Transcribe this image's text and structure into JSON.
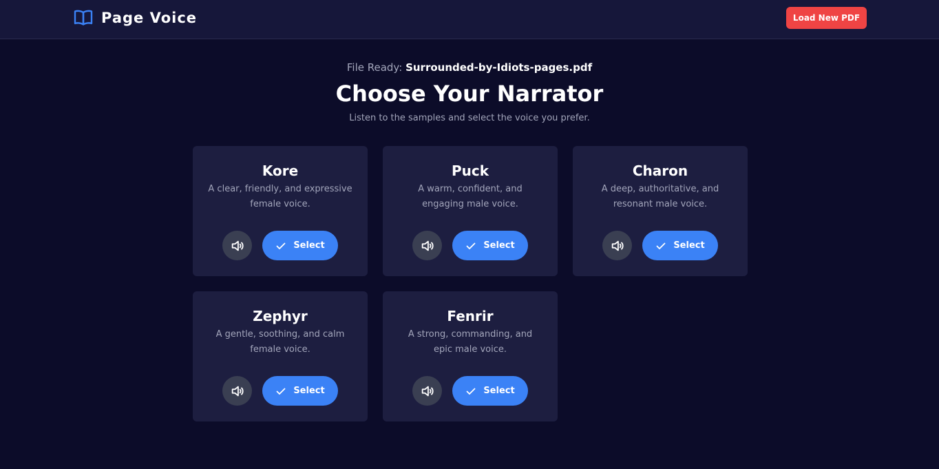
{
  "header": {
    "brand_name": "Page Voice",
    "brand_icon": "open-book-icon",
    "load_button_label": "Load New PDF"
  },
  "main": {
    "file_ready_label": "File Ready:",
    "file_name": "Surrounded-by-Idiots-pages.pdf",
    "title": "Choose Your Narrator",
    "subtitle": "Listen to the samples and select the voice you prefer."
  },
  "voices": [
    {
      "name": "Kore",
      "description": "A clear, friendly, and expressive female voice.",
      "select_label": "Select"
    },
    {
      "name": "Puck",
      "description": "A warm, confident, and engaging male voice.",
      "select_label": "Select"
    },
    {
      "name": "Charon",
      "description": "A deep, authoritative, and resonant male voice.",
      "select_label": "Select"
    },
    {
      "name": "Zephyr",
      "description": "A gentle, soothing, and calm female voice.",
      "select_label": "Select"
    },
    {
      "name": "Fenrir",
      "description": "A strong, commanding, and epic male voice.",
      "select_label": "Select"
    }
  ],
  "icons": {
    "play": "speaker-icon",
    "select": "check-icon"
  },
  "colors": {
    "background": "#0c0c29",
    "header_bg": "#16173a",
    "card_bg": "#1d1e40",
    "accent": "#3b82f6",
    "danger": "#ef4444",
    "muted_text": "#a3a6bb",
    "play_button_bg": "#3a3f52"
  }
}
